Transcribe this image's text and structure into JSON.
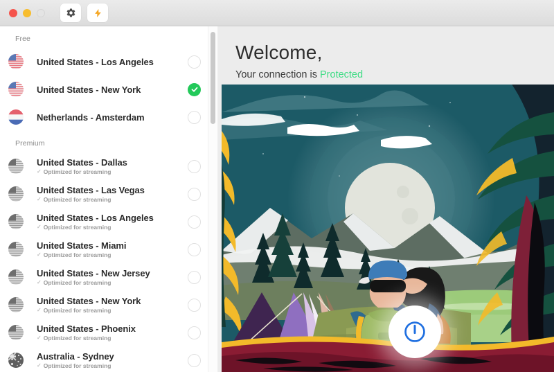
{
  "titlebar": {
    "close_label": "close",
    "minimize_label": "minimize",
    "zoom_label": "zoom",
    "settings_icon": "gear-icon",
    "boost_icon": "lightning-bolt-icon",
    "boost_color": "#f5a623"
  },
  "sidebar": {
    "sections": [
      {
        "label": "Free",
        "items": [
          {
            "name": "United States - Los Angeles",
            "flag": "us",
            "selected": false,
            "subtitle": ""
          },
          {
            "name": "United States - New York",
            "flag": "us",
            "selected": true,
            "subtitle": ""
          },
          {
            "name": "Netherlands - Amsterdam",
            "flag": "nl",
            "selected": false,
            "subtitle": ""
          }
        ]
      },
      {
        "label": "Premium",
        "items": [
          {
            "name": "United States - Dallas",
            "flag": "us-gray",
            "selected": false,
            "subtitle": "Optimized for streaming"
          },
          {
            "name": "United States - Las Vegas",
            "flag": "us-gray",
            "selected": false,
            "subtitle": "Optimized for streaming"
          },
          {
            "name": "United States - Los Angeles",
            "flag": "us-gray",
            "selected": false,
            "subtitle": "Optimized for streaming"
          },
          {
            "name": "United States - Miami",
            "flag": "us-gray",
            "selected": false,
            "subtitle": "Optimized for streaming"
          },
          {
            "name": "United States - New Jersey",
            "flag": "us-gray",
            "selected": false,
            "subtitle": "Optimized for streaming"
          },
          {
            "name": "United States - New York",
            "flag": "us-gray",
            "selected": false,
            "subtitle": "Optimized for streaming"
          },
          {
            "name": "United States - Phoenix",
            "flag": "us-gray",
            "selected": false,
            "subtitle": "Optimized for streaming"
          },
          {
            "name": "Australia - Sydney",
            "flag": "au-gray",
            "selected": false,
            "subtitle": "Optimized for streaming"
          }
        ]
      }
    ],
    "subtitle_check_glyph": "✓",
    "selected_check_glyph": "✓",
    "selected_color": "#23c95a"
  },
  "main": {
    "welcome": "Welcome,",
    "status_prefix": "Your connection is ",
    "status_value": "Protected",
    "status_color": "#3ddc84",
    "power_button_icon": "power-icon",
    "power_button_color": "#1f6fe0",
    "illustration": "night-camping-scene"
  }
}
